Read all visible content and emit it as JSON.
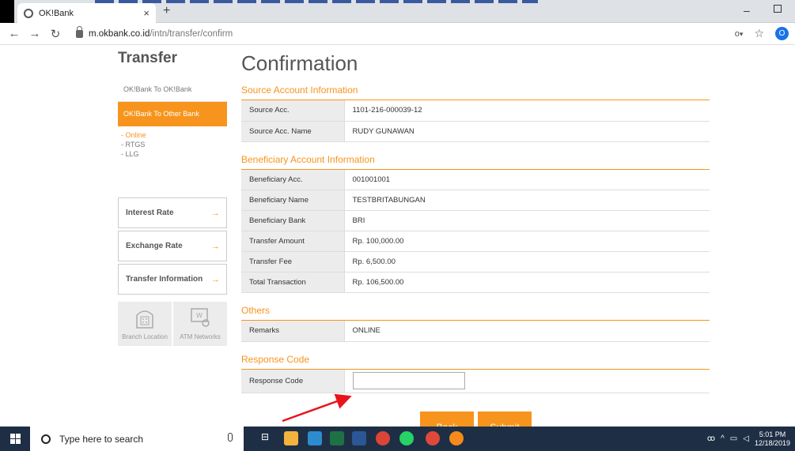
{
  "browser": {
    "tab_title": "OK!Bank",
    "tab_close": "×",
    "new_tab": "+",
    "url_host": "m.okbank.co.id",
    "url_path": "/intn/transfer/confirm",
    "profile_initial": "O"
  },
  "sidebar": {
    "title": "Transfer",
    "items": [
      {
        "label": "OK!Bank To OK!Bank"
      },
      {
        "label": "OK!Bank To Other Bank"
      }
    ],
    "subitems": [
      "- Online",
      "- RTGS",
      "- LLG"
    ],
    "boxes": [
      {
        "label": "Interest Rate"
      },
      {
        "label": "Exchange Rate"
      },
      {
        "label": "Transfer Information"
      }
    ],
    "arrow": "→",
    "tiles": [
      {
        "label": "Branch Location"
      },
      {
        "label": "ATM Networks"
      }
    ]
  },
  "main": {
    "title": "Confirmation",
    "source_section": "Source Account Information",
    "source_rows": [
      {
        "label": "Source Acc.",
        "value": "1101-216-000039-12"
      },
      {
        "label": "Source Acc. Name",
        "value": "RUDY GUNAWAN"
      }
    ],
    "beneficiary_section": "Beneficiary Account Information",
    "beneficiary_rows": [
      {
        "label": "Beneficiary Acc.",
        "value": "001001001"
      },
      {
        "label": "Beneficiary Name",
        "value": "TESTBRITABUNGAN"
      },
      {
        "label": "Beneficiary Bank",
        "value": "BRI"
      },
      {
        "label": "Transfer Amount",
        "value": "Rp. 100,000.00"
      },
      {
        "label": "Transfer Fee",
        "value": "Rp. 6,500.00"
      },
      {
        "label": "Total Transaction",
        "value": "Rp. 106,500.00"
      }
    ],
    "others_section": "Others",
    "others_rows": [
      {
        "label": "Remarks",
        "value": "ONLINE"
      }
    ],
    "response_section": "Response Code",
    "response_label": "Response Code",
    "response_value": "",
    "back_label": "Back",
    "submit_label": "Submit"
  },
  "taskbar": {
    "search_placeholder": "Type here to search",
    "time": "5:01 PM",
    "date": "12/18/2019"
  },
  "colors": {
    "accent": "#f7941d",
    "annotation_arrow": "#e8141c"
  }
}
